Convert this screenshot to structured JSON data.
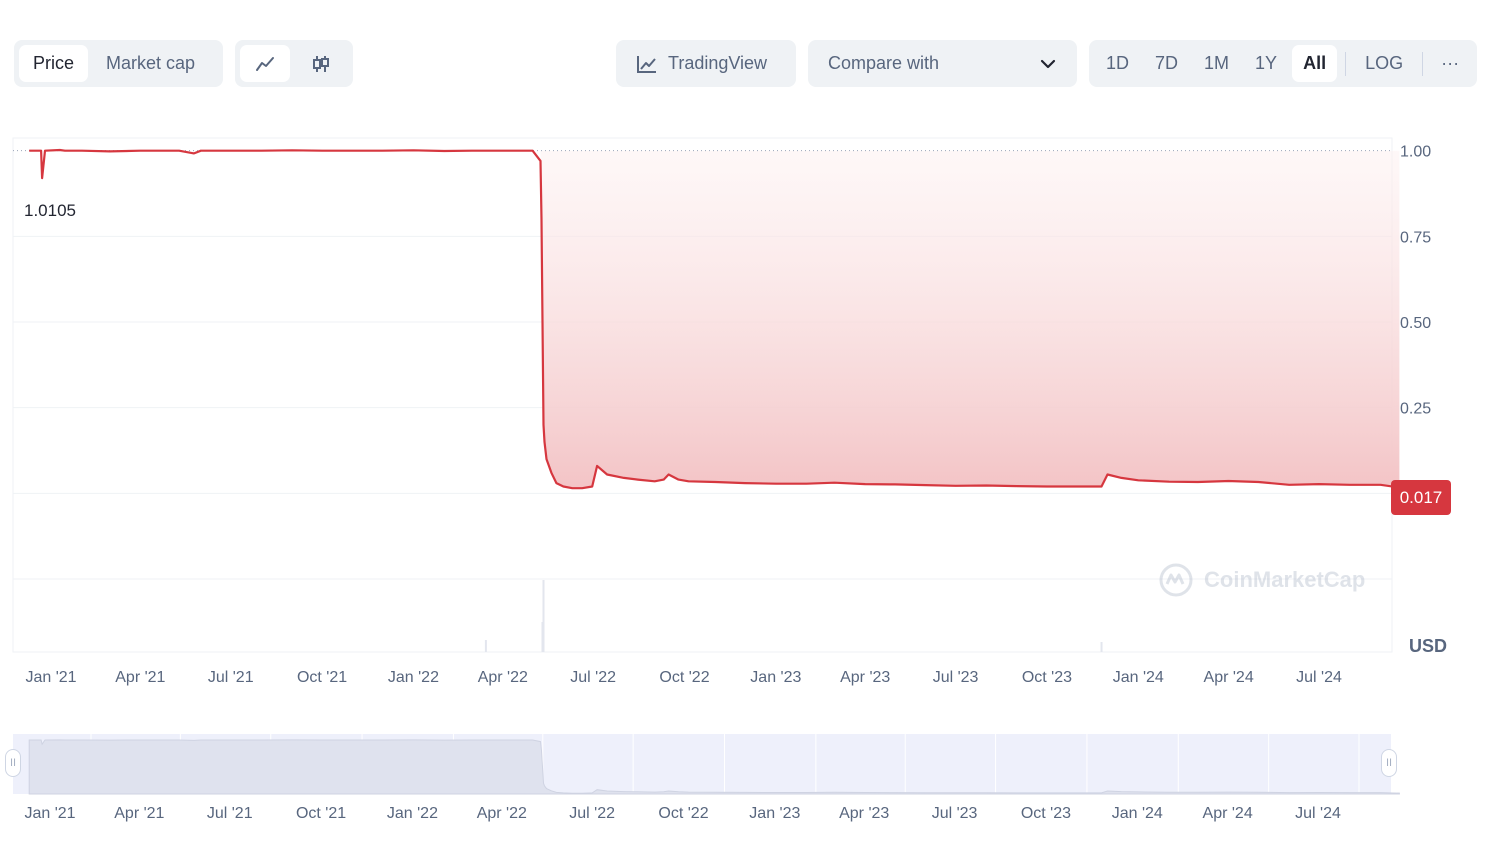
{
  "toolbar": {
    "tabs": [
      "Price",
      "Market cap"
    ],
    "active_tab": "Price",
    "chart_types": [
      "line-icon",
      "candlestick-icon"
    ],
    "tradingview_label": "TradingView",
    "compare_label": "Compare with",
    "ranges": [
      "1D",
      "7D",
      "1M",
      "1Y",
      "All"
    ],
    "active_range": "All",
    "log_label": "LOG",
    "more_label": "···"
  },
  "chart": {
    "currency_label": "USD",
    "current_price_label": "0.017",
    "max_label": "1.0105",
    "watermark": "CoinMarketCap",
    "colors": {
      "line": "#d6373f",
      "area_top": "#fdf0f0",
      "area_bottom": "#f3c4c6",
      "tag_bg": "#d6373f",
      "navigator": "#eef0fb"
    }
  },
  "chart_data": {
    "type": "line",
    "x_axis_ticks": [
      "Jan '21",
      "Apr '21",
      "Jul '21",
      "Oct '21",
      "Jan '22",
      "Apr '22",
      "Jul '22",
      "Oct '22",
      "Jan '23",
      "Apr '23",
      "Jul '23",
      "Oct '23",
      "Jan '24",
      "Apr '24",
      "Jul '24"
    ],
    "y_axis_ticks": [
      0.25,
      0.5,
      0.75,
      1.0
    ],
    "ylim": [
      -0.25,
      1.25
    ],
    "series": [
      {
        "x": [
          "2020-12-10",
          "2020-12-22",
          "2020-12-23",
          "2020-12-26",
          "2021-01-10",
          "2021-01-15",
          "2021-02-01",
          "2021-03-01",
          "2021-04-01",
          "2021-05-10",
          "2021-05-25",
          "2021-06-01",
          "2021-07-01",
          "2021-08-01",
          "2021-09-01",
          "2021-10-01",
          "2021-11-01",
          "2021-12-01",
          "2022-01-01",
          "2022-02-01",
          "2022-03-01",
          "2022-04-01",
          "2022-05-01",
          "2022-05-09",
          "2022-05-10",
          "2022-05-11",
          "2022-05-12",
          "2022-05-13",
          "2022-05-15",
          "2022-05-20",
          "2022-05-25",
          "2022-06-01",
          "2022-06-10",
          "2022-06-20",
          "2022-06-30",
          "2022-07-05",
          "2022-07-15",
          "2022-08-01",
          "2022-08-15",
          "2022-09-01",
          "2022-09-10",
          "2022-09-15",
          "2022-09-25",
          "2022-10-05",
          "2022-11-01",
          "2022-12-01",
          "2023-01-01",
          "2023-02-01",
          "2023-03-01",
          "2023-04-01",
          "2023-05-01",
          "2023-06-01",
          "2023-07-01",
          "2023-08-01",
          "2023-09-01",
          "2023-10-01",
          "2023-11-01",
          "2023-11-25",
          "2023-12-01",
          "2023-12-15",
          "2024-01-01",
          "2024-02-01",
          "2024-03-01",
          "2024-04-01",
          "2024-05-01",
          "2024-06-01",
          "2024-07-01",
          "2024-08-01",
          "2024-09-01",
          "2024-09-20"
        ],
        "values": [
          1.0,
          1.0,
          0.92,
          1.0,
          1.002,
          1.0,
          1.0,
          0.998,
          1.0,
          1.0,
          0.992,
          1.0,
          1.0,
          1.0,
          1.001,
          1.0,
          1.0,
          1.0,
          1.001,
          0.999,
          1.0,
          1.0,
          1.0,
          0.97,
          0.8,
          0.5,
          0.2,
          0.15,
          0.1,
          0.06,
          0.03,
          0.02,
          0.015,
          0.015,
          0.02,
          0.08,
          0.055,
          0.045,
          0.04,
          0.035,
          0.04,
          0.055,
          0.04,
          0.035,
          0.033,
          0.03,
          0.028,
          0.028,
          0.031,
          0.027,
          0.026,
          0.024,
          0.022,
          0.023,
          0.021,
          0.02,
          0.02,
          0.02,
          0.055,
          0.045,
          0.038,
          0.034,
          0.033,
          0.036,
          0.033,
          0.025,
          0.027,
          0.025,
          0.025,
          0.017
        ]
      }
    ]
  }
}
